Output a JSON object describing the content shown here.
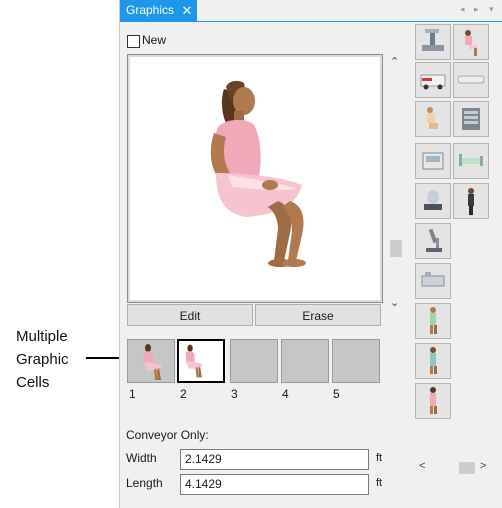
{
  "annotation": {
    "lines": [
      "Multiple",
      "Graphic",
      "Cells"
    ]
  },
  "tab": {
    "label": "Graphics",
    "close_glyph": "✕"
  },
  "new_checkbox": {
    "label": "New",
    "checked": false
  },
  "buttons": {
    "edit": "Edit",
    "erase": "Erase"
  },
  "cells": [
    {
      "number": "1",
      "selected": false,
      "graphic": "seated-woman-icon"
    },
    {
      "number": "2",
      "selected": true,
      "graphic": "seated-woman-icon"
    },
    {
      "number": "3",
      "selected": false,
      "graphic": ""
    },
    {
      "number": "4",
      "selected": false,
      "graphic": ""
    },
    {
      "number": "5",
      "selected": false,
      "graphic": ""
    }
  ],
  "conveyor": {
    "heading": "Conveyor Only:",
    "width_label": "Width",
    "width_value": "2.1429",
    "length_label": "Length",
    "length_value": "4.1429",
    "unit": "ft"
  },
  "palette": [
    "x-ray-machine-icon",
    "seated-patient-icon",
    "ambulance-icon",
    "stretcher-pad-icon",
    "bandaged-patient-icon",
    "server-cabinet-icon",
    "monitor-device-icon",
    "hospital-bed-icon",
    "scale-device-icon",
    "standing-person-dark-icon",
    "microscope-icon",
    "",
    "lab-equipment-icon",
    "",
    "walking-patient-green-icon",
    "",
    "standing-patient-teal-icon",
    "",
    "standing-patient-pink-icon",
    ""
  ],
  "colors": {
    "tab_accent": "#1c97ea",
    "dress_pink": "#f4b6c2",
    "skin": "#b07a4e",
    "hair": "#5a3520"
  }
}
